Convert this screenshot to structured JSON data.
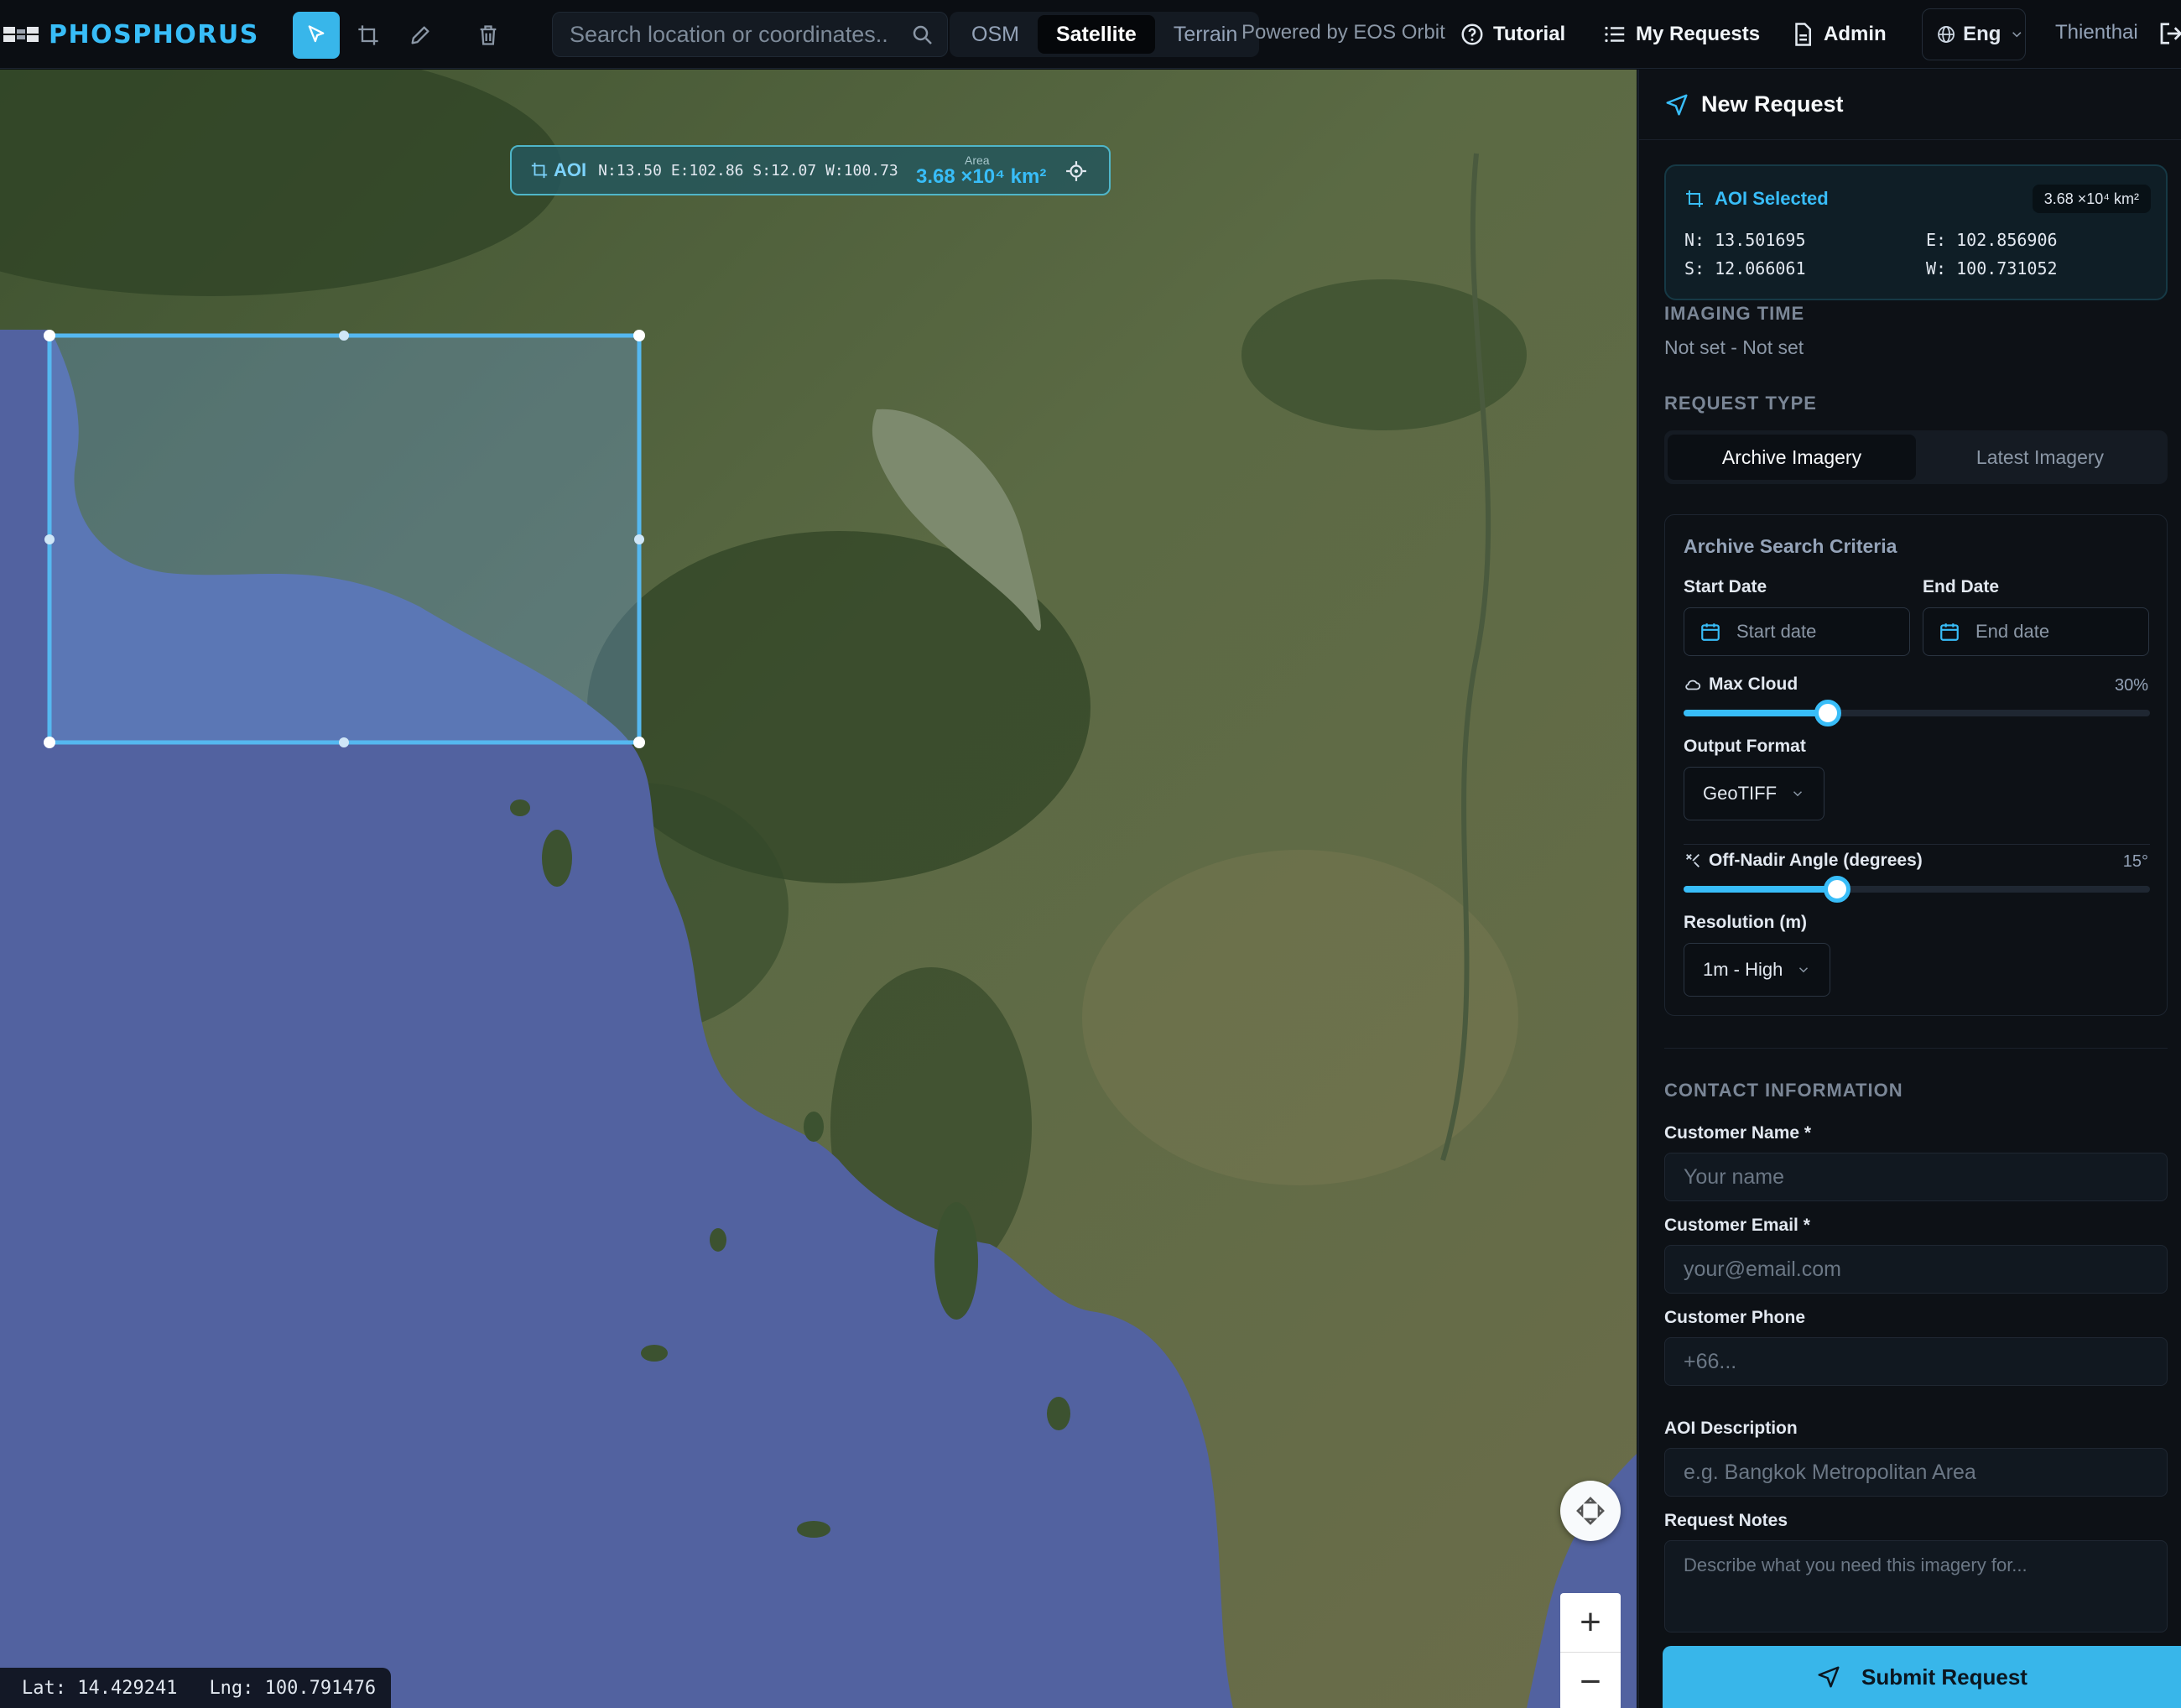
{
  "app": {
    "name": "PHOSPHORUS"
  },
  "toolbar": {
    "search_placeholder": "Search location or coordinates...",
    "map_types": [
      "OSM",
      "Satellite",
      "Terrain"
    ],
    "active_map_type": "Satellite",
    "powered_by": "Powered by EOS Orbit",
    "tutorial": "Tutorial",
    "my_requests": "My Requests",
    "admin": "Admin",
    "language": "Eng",
    "user": "Thienthai"
  },
  "map": {
    "aoi_bar": {
      "label": "AOI",
      "coords": "N:13.50 E:102.86 S:12.07 W:100.73",
      "area_label": "Area",
      "area": "3.68 ×10⁴ km²"
    },
    "cursor": {
      "lat": "Lat: 14.429241",
      "lng": "Lng: 100.791476"
    },
    "zoom_in": "+",
    "zoom_out": "−"
  },
  "panel": {
    "title": "New Request",
    "aoi_card": {
      "title": "AOI Selected",
      "area": "3.68 ×10⁴ km²",
      "n": "N: 13.501695",
      "e": "E: 102.856906",
      "s": "S: 12.066061",
      "w": "W: 100.731052"
    },
    "imaging_time_title": "IMAGING TIME",
    "imaging_time_value": "Not set - Not set",
    "request_type_title": "REQUEST TYPE",
    "request_types": [
      "Archive Imagery",
      "Latest Imagery"
    ],
    "active_request_type": "Archive Imagery",
    "criteria": {
      "title": "Archive Search Criteria",
      "start_label": "Start Date",
      "end_label": "End Date",
      "start_placeholder": "Start date",
      "end_placeholder": "End date",
      "cloud_label": "Max Cloud",
      "cloud_value": "30%",
      "cloud_fraction": 0.31,
      "format_label": "Output Format",
      "format_value": "GeoTIFF",
      "angle_label": "Off-Nadir Angle (degrees)",
      "angle_value": "15°",
      "angle_fraction": 0.33,
      "resolution_label": "Resolution (m)",
      "resolution_value": "1m - High"
    },
    "contact_title": "CONTACT INFORMATION",
    "name_label": "Customer Name *",
    "name_placeholder": "Your name",
    "email_label": "Customer Email *",
    "email_placeholder": "your@email.com",
    "phone_label": "Customer Phone",
    "phone_placeholder": "+66...",
    "aoi_desc_label": "AOI Description",
    "aoi_desc_placeholder": "e.g. Bangkok Metropolitan Area",
    "notes_label": "Request Notes",
    "notes_placeholder": "Describe what you need this imagery for...",
    "submit": "Submit Request"
  },
  "colors": {
    "accent": "#38b6ea",
    "background": "#0d1116",
    "sea": "#5262a0"
  }
}
